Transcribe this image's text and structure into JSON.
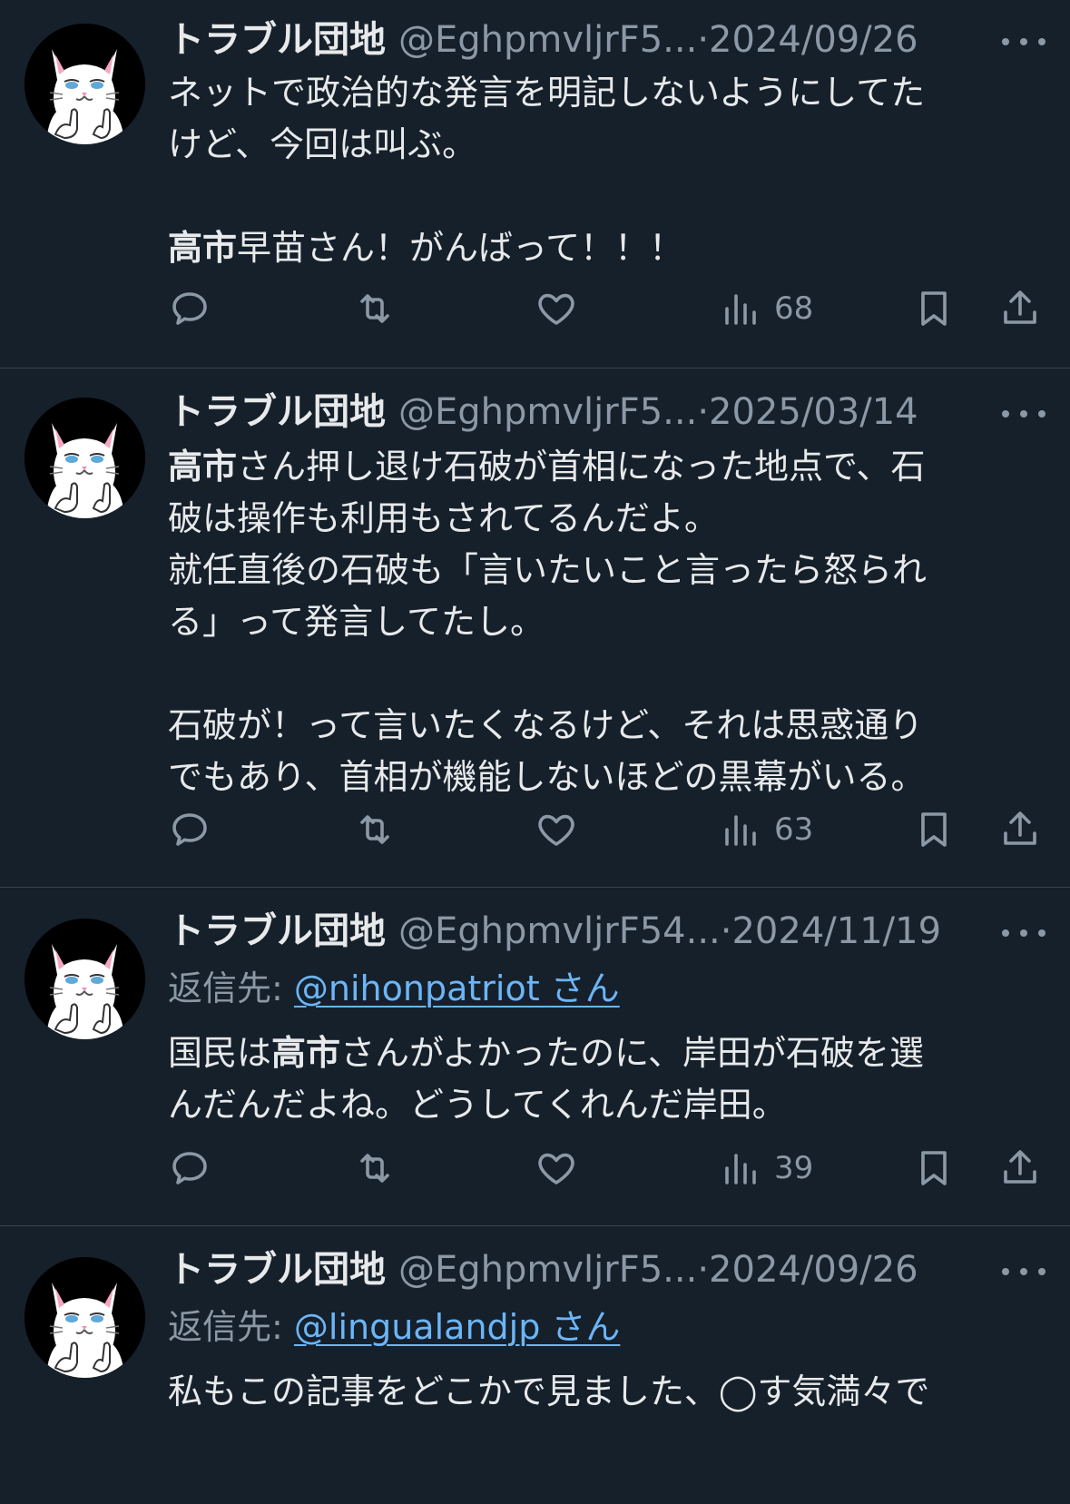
{
  "tweets": [
    {
      "author": "トラブル団地",
      "handle": "@EghpmvljrF5...",
      "separator": "·",
      "date": "2024/09/26",
      "reply_prefix": "",
      "reply_to": "",
      "lines": [
        [
          {
            "t": "ネットで政治的な発言を明記しないようにしてた"
          }
        ],
        [
          {
            "t": "けど、今回は叫ぶ。"
          }
        ],
        [],
        [
          {
            "t": "高市",
            "b": true
          },
          {
            "t": "早苗さん！がんばって！！！"
          }
        ]
      ],
      "views": "68"
    },
    {
      "author": "トラブル団地",
      "handle": "@EghpmvljrF5...",
      "separator": "·",
      "date": "2025/03/14",
      "reply_prefix": "",
      "reply_to": "",
      "lines": [
        [
          {
            "t": "高市",
            "b": true
          },
          {
            "t": "さん押し退け石破が首相になった地点で、石"
          }
        ],
        [
          {
            "t": "破は操作も利用もされてるんだよ。"
          }
        ],
        [
          {
            "t": "就任直後の石破も「言いたいこと言ったら怒られ"
          }
        ],
        [
          {
            "t": "る」って発言してたし。"
          }
        ],
        [],
        [
          {
            "t": "石破が！って言いたくなるけど、それは思惑通り"
          }
        ],
        [
          {
            "t": "でもあり、首相が機能しないほどの黒幕がいる。"
          }
        ]
      ],
      "views": "63"
    },
    {
      "author": "トラブル団地",
      "handle": "@EghpmvljrF54...",
      "separator": "·",
      "date": "2024/11/19",
      "reply_prefix": "返信先:",
      "reply_to": "@nihonpatriot さん",
      "lines": [
        [
          {
            "t": "国民は"
          },
          {
            "t": "高市",
            "b": true
          },
          {
            "t": "さんがよかったのに、岸田が石破を選"
          }
        ],
        [
          {
            "t": "んだんだよね。どうしてくれんだ岸田。"
          }
        ]
      ],
      "views": "39"
    },
    {
      "author": "トラブル団地",
      "handle": "@EghpmvljrF5...",
      "separator": "·",
      "date": "2024/09/26",
      "reply_prefix": "返信先:",
      "reply_to": "@lingualandjp さん",
      "lines": [
        [
          {
            "t": "私もこの記事をどこかで見ました、◯す気満々で"
          }
        ]
      ],
      "views": ""
    }
  ],
  "icons": {
    "avatar": "white-cat-avatar",
    "more": "more-dots-icon",
    "reply": "reply-bubble-icon",
    "retweet": "retweet-icon",
    "like": "heart-icon",
    "views": "views-chart-icon",
    "bookmark": "bookmark-icon",
    "share": "share-icon"
  },
  "colors": {
    "background": "#15202b",
    "text": "#e7e9ea",
    "secondary": "#8b98a5",
    "link": "#6cb5f6",
    "divider": "#38444d"
  }
}
